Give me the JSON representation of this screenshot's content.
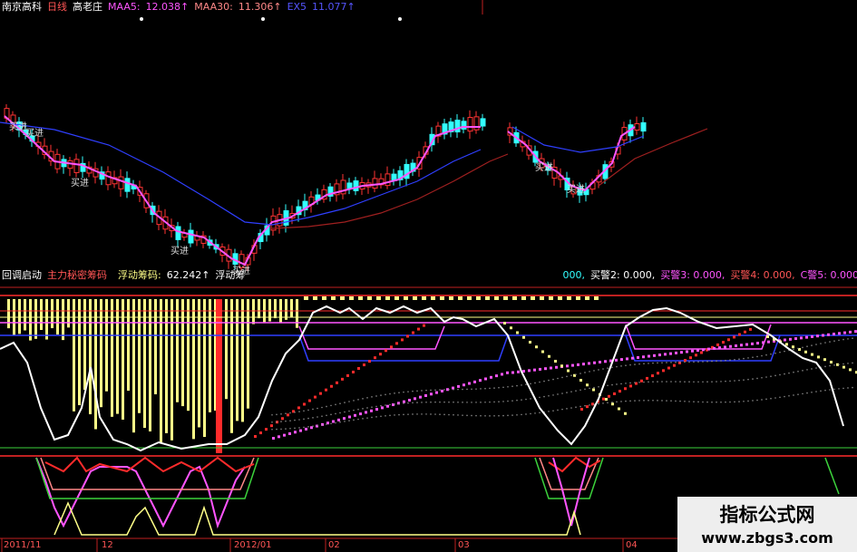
{
  "top_bar": {
    "stock_name": "南京高科",
    "period": "日线",
    "tag": "高老庄",
    "ma5_label": "MAA5:",
    "ma5_value": "12.038↑",
    "ma30_label": "MAA30:",
    "ma30_value": "11.306↑",
    "extra_label": "EX5",
    "extra_value": "11.077↑"
  },
  "price_annotations": [
    "买进",
    "买进",
    "买进",
    "买进",
    "买进",
    "买进",
    "买进"
  ],
  "mid_bar": {
    "indicator_name": "回调启动",
    "main_label": "主力秘密筹码",
    "float_label": "浮动筹码:",
    "float_value": "62.242↑",
    "float_label2": "浮动筹",
    "right_prefix": "000,",
    "buy2": "买警2: 0.000,",
    "buy3": "买警3: 0.000,",
    "buy4": "买警4: 0.000,",
    "buy5": "C警5: 0.000"
  },
  "date_axis": [
    "2011/11",
    "12",
    "2012/01",
    "02",
    "03",
    "04"
  ],
  "watermark": {
    "name": "指标公式网",
    "url": "www.zbgs3.com"
  },
  "colors": {
    "bg": "#000000",
    "red": "#ff2b2b",
    "cyan": "#33ffff",
    "magenta": "#ff55ff",
    "yellow": "#ffff88",
    "blue": "#2f3fff",
    "white": "#ffffff",
    "green": "#3cd23c",
    "darkred": "#c02020"
  }
}
